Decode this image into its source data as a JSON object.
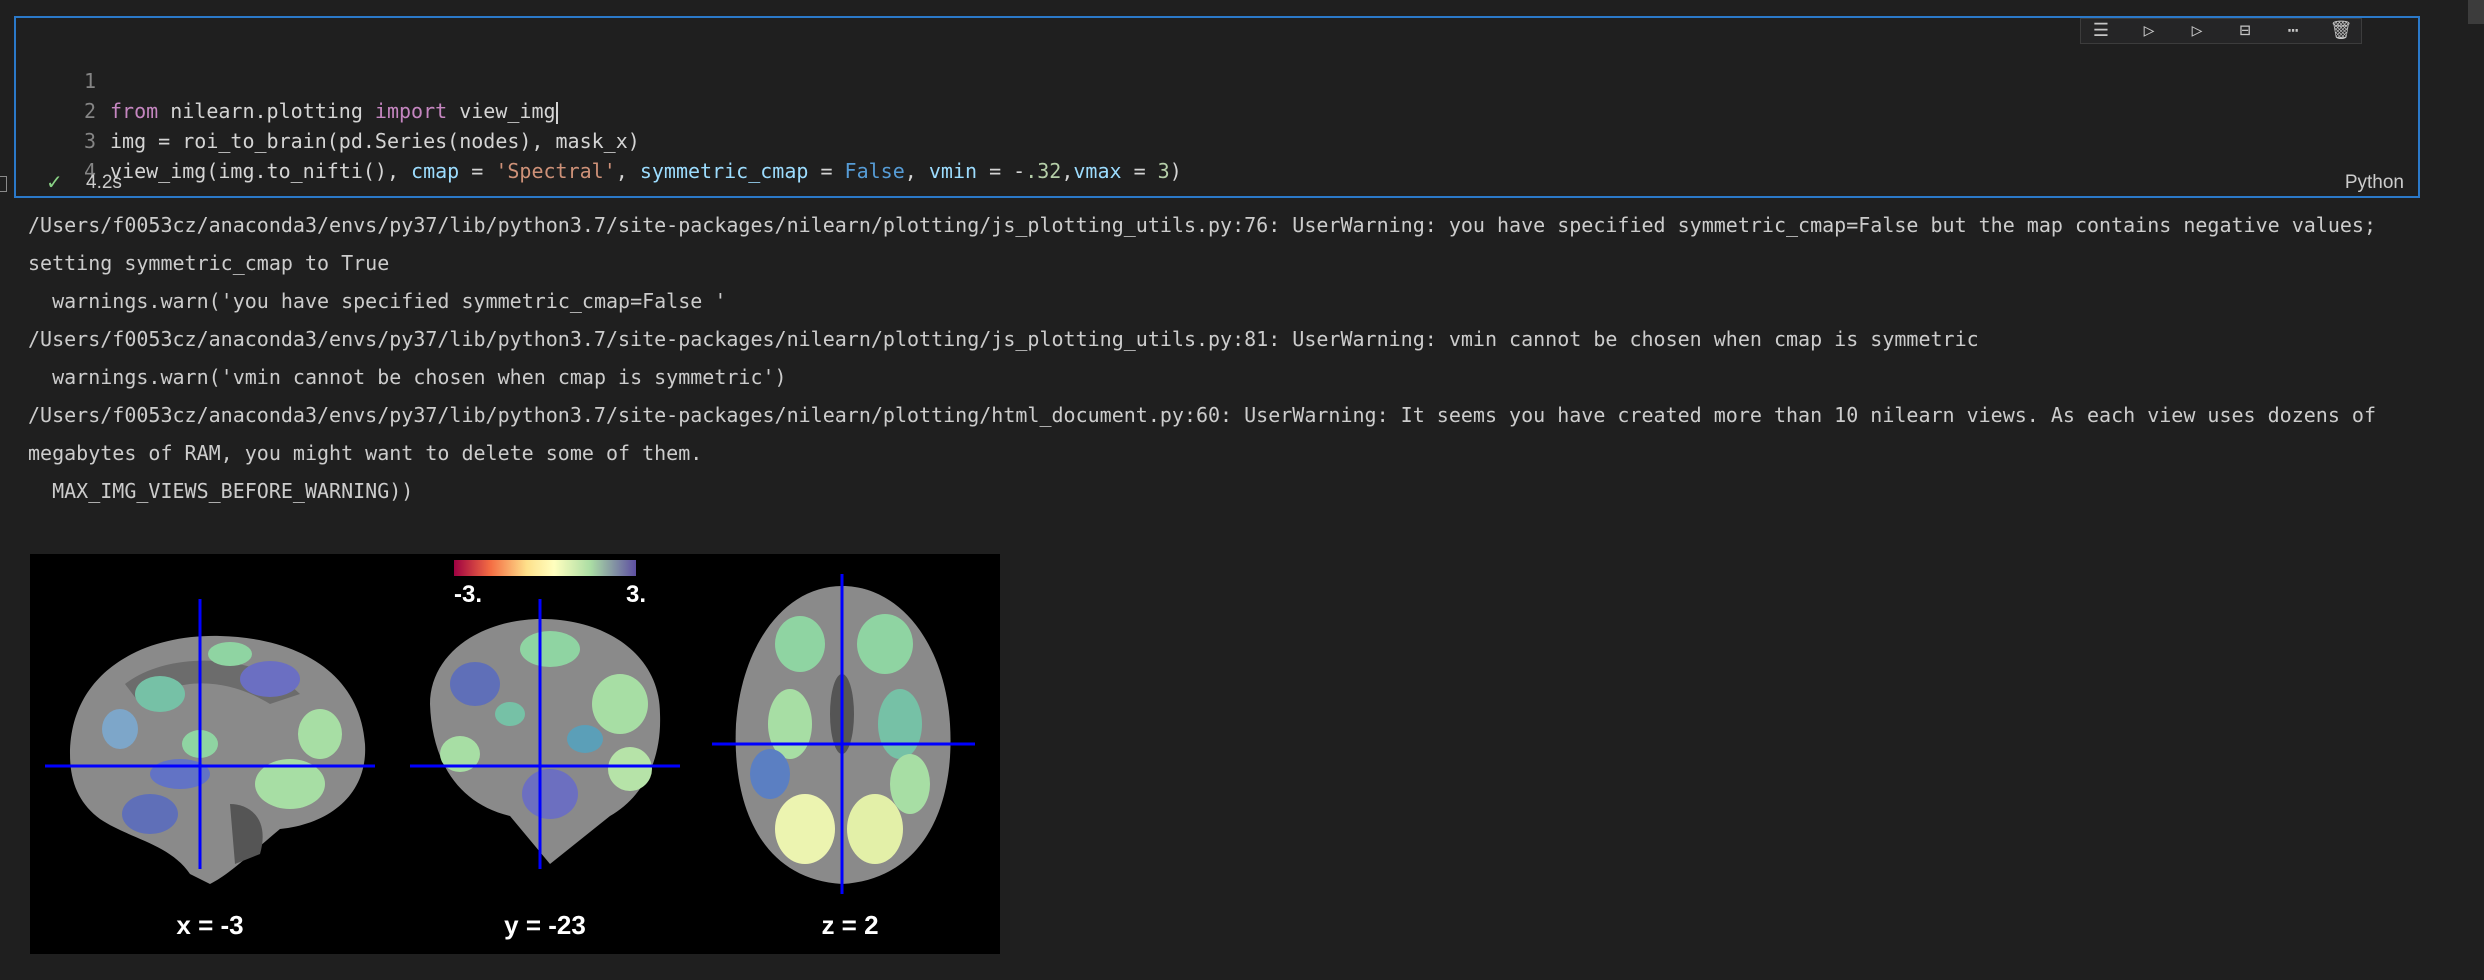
{
  "cell": {
    "lines": [
      {
        "n": "1"
      },
      {
        "n": "2"
      },
      {
        "n": "3"
      },
      {
        "n": "4"
      }
    ],
    "code": {
      "l1_from": "from",
      "l1_mod": " nilearn.plotting ",
      "l1_import": "import",
      "l1_name": " view_img",
      "l2": "img = roi_to_brain(pd.Series(nodes), mask_x)",
      "l3_a": "view_img(img.to_nifti(), ",
      "l3_cmap": "cmap",
      "l3_b": " = ",
      "l3_spectral": "'Spectral'",
      "l3_c": ", ",
      "l3_sym": "symmetric_cmap",
      "l3_d": " = ",
      "l3_false": "False",
      "l3_e": ", ",
      "l3_vmin": "vmin",
      "l3_f": " = -",
      "l3_n1": ".32",
      "l3_g": ",",
      "l3_vmax": "vmax",
      "l3_h": " = ",
      "l3_n2": "3",
      "l3_i": ")"
    },
    "exec_time": "4.2s",
    "language": "Python",
    "toolbar": [
      "run-by-line-icon",
      "execute-above-icon",
      "execute-below-icon",
      "split-cell-icon",
      "more-actions-icon",
      "delete-cell-icon"
    ]
  },
  "output": {
    "text": "/Users/f0053cz/anaconda3/envs/py37/lib/python3.7/site-packages/nilearn/plotting/js_plotting_utils.py:76: UserWarning: you have specified symmetric_cmap=False but the map contains negative values;\nsetting symmetric_cmap to True\n  warnings.warn('you have specified symmetric_cmap=False '\n/Users/f0053cz/anaconda3/envs/py37/lib/python3.7/site-packages/nilearn/plotting/js_plotting_utils.py:81: UserWarning: vmin cannot be chosen when cmap is symmetric\n  warnings.warn('vmin cannot be chosen when cmap is symmetric')\n/Users/f0053cz/anaconda3/envs/py37/lib/python3.7/site-packages/nilearn/plotting/html_document.py:60: UserWarning: It seems you have created more than 10 nilearn views. As each view uses dozens of\nmegabytes of RAM, you might want to delete some of them.\n  MAX_IMG_VIEWS_BEFORE_WARNING))"
  },
  "viewer": {
    "colorbar_min": "-3.",
    "colorbar_max": "3.",
    "labels": [
      "x = -3",
      "y = -23",
      "z = 2"
    ],
    "crosshair_color": "#0000ff"
  }
}
